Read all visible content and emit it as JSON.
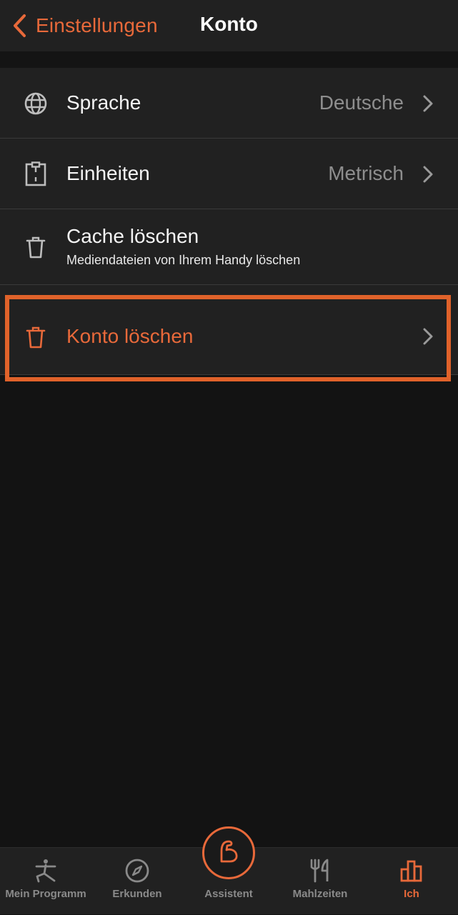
{
  "nav": {
    "back_label": "Einstellungen",
    "title": "Konto"
  },
  "settings": {
    "language": {
      "label": "Sprache",
      "value": "Deutsche",
      "icon": "globe-icon"
    },
    "units": {
      "label": "Einheiten",
      "value": "Metrisch",
      "icon": "ruler-clipboard-icon"
    },
    "cache": {
      "label": "Cache löschen",
      "subtitle": "Mediendateien von Ihrem Handy löschen",
      "icon": "trash-icon"
    },
    "delete_account": {
      "label": "Konto löschen",
      "icon": "trash-icon"
    }
  },
  "tabbar": {
    "items": [
      {
        "label": "Mein Programm",
        "icon": "stretching-figure-icon",
        "active": false
      },
      {
        "label": "Erkunden",
        "icon": "compass-icon",
        "active": false
      },
      {
        "label": "Assistent",
        "icon": "flexed-arm-icon",
        "active": false
      },
      {
        "label": "Mahlzeiten",
        "icon": "fork-knife-icon",
        "active": false
      },
      {
        "label": "Ich",
        "icon": "bar-chart-icon",
        "active": true
      }
    ]
  },
  "colors": {
    "accent": "#e8693a",
    "highlight": "#e0622a",
    "background": "#131313",
    "surface": "#212121",
    "muted_text": "#8e8e8e"
  }
}
